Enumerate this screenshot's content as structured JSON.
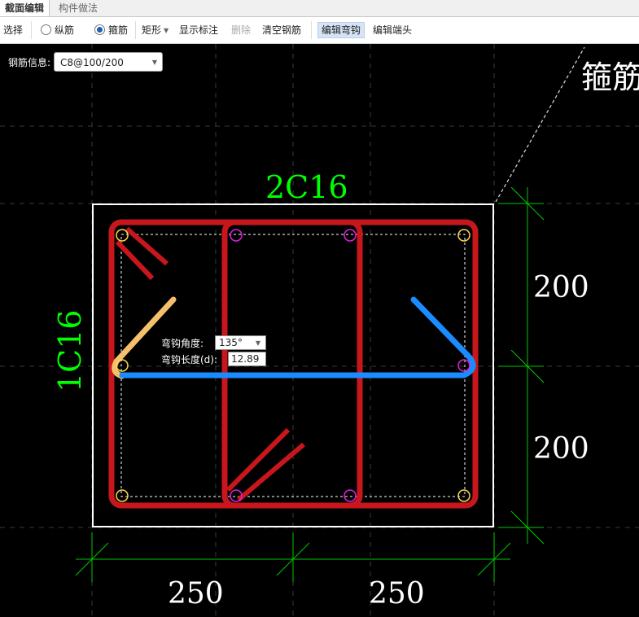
{
  "tabs": [
    {
      "label": "截面编辑",
      "active": true
    },
    {
      "label": "构件做法",
      "active": false
    }
  ],
  "toolbar": {
    "select": "选择",
    "longitudinal": "纵筋",
    "stirrup": "箍筋",
    "shape": "矩形",
    "show_annotation": "显示标注",
    "delete": "删除",
    "clear_rebar": "清空钢筋",
    "edit_hook": "编辑弯钩",
    "edit_end": "编辑端头"
  },
  "rebar_info": {
    "label": "钢筋信息:",
    "value": "C8@100/200"
  },
  "drawing": {
    "top_rebar": "2C16",
    "side_rebar": "1C16",
    "top_right_text": "箍筋",
    "dims": {
      "right_upper": "200",
      "right_lower": "200",
      "bottom_left": "250",
      "bottom_right": "250"
    }
  },
  "hook_editor": {
    "angle_label": "弯钩角度:",
    "angle_value": "135°",
    "length_label": "弯钩长度(d):",
    "length_value": "12.89"
  },
  "colors": {
    "stirrup": "#c8161d",
    "hook_selected": "#f5c06b",
    "tie_selected": "#1a8cff",
    "dimension": "#00d000",
    "text_green": "#00ff00"
  }
}
